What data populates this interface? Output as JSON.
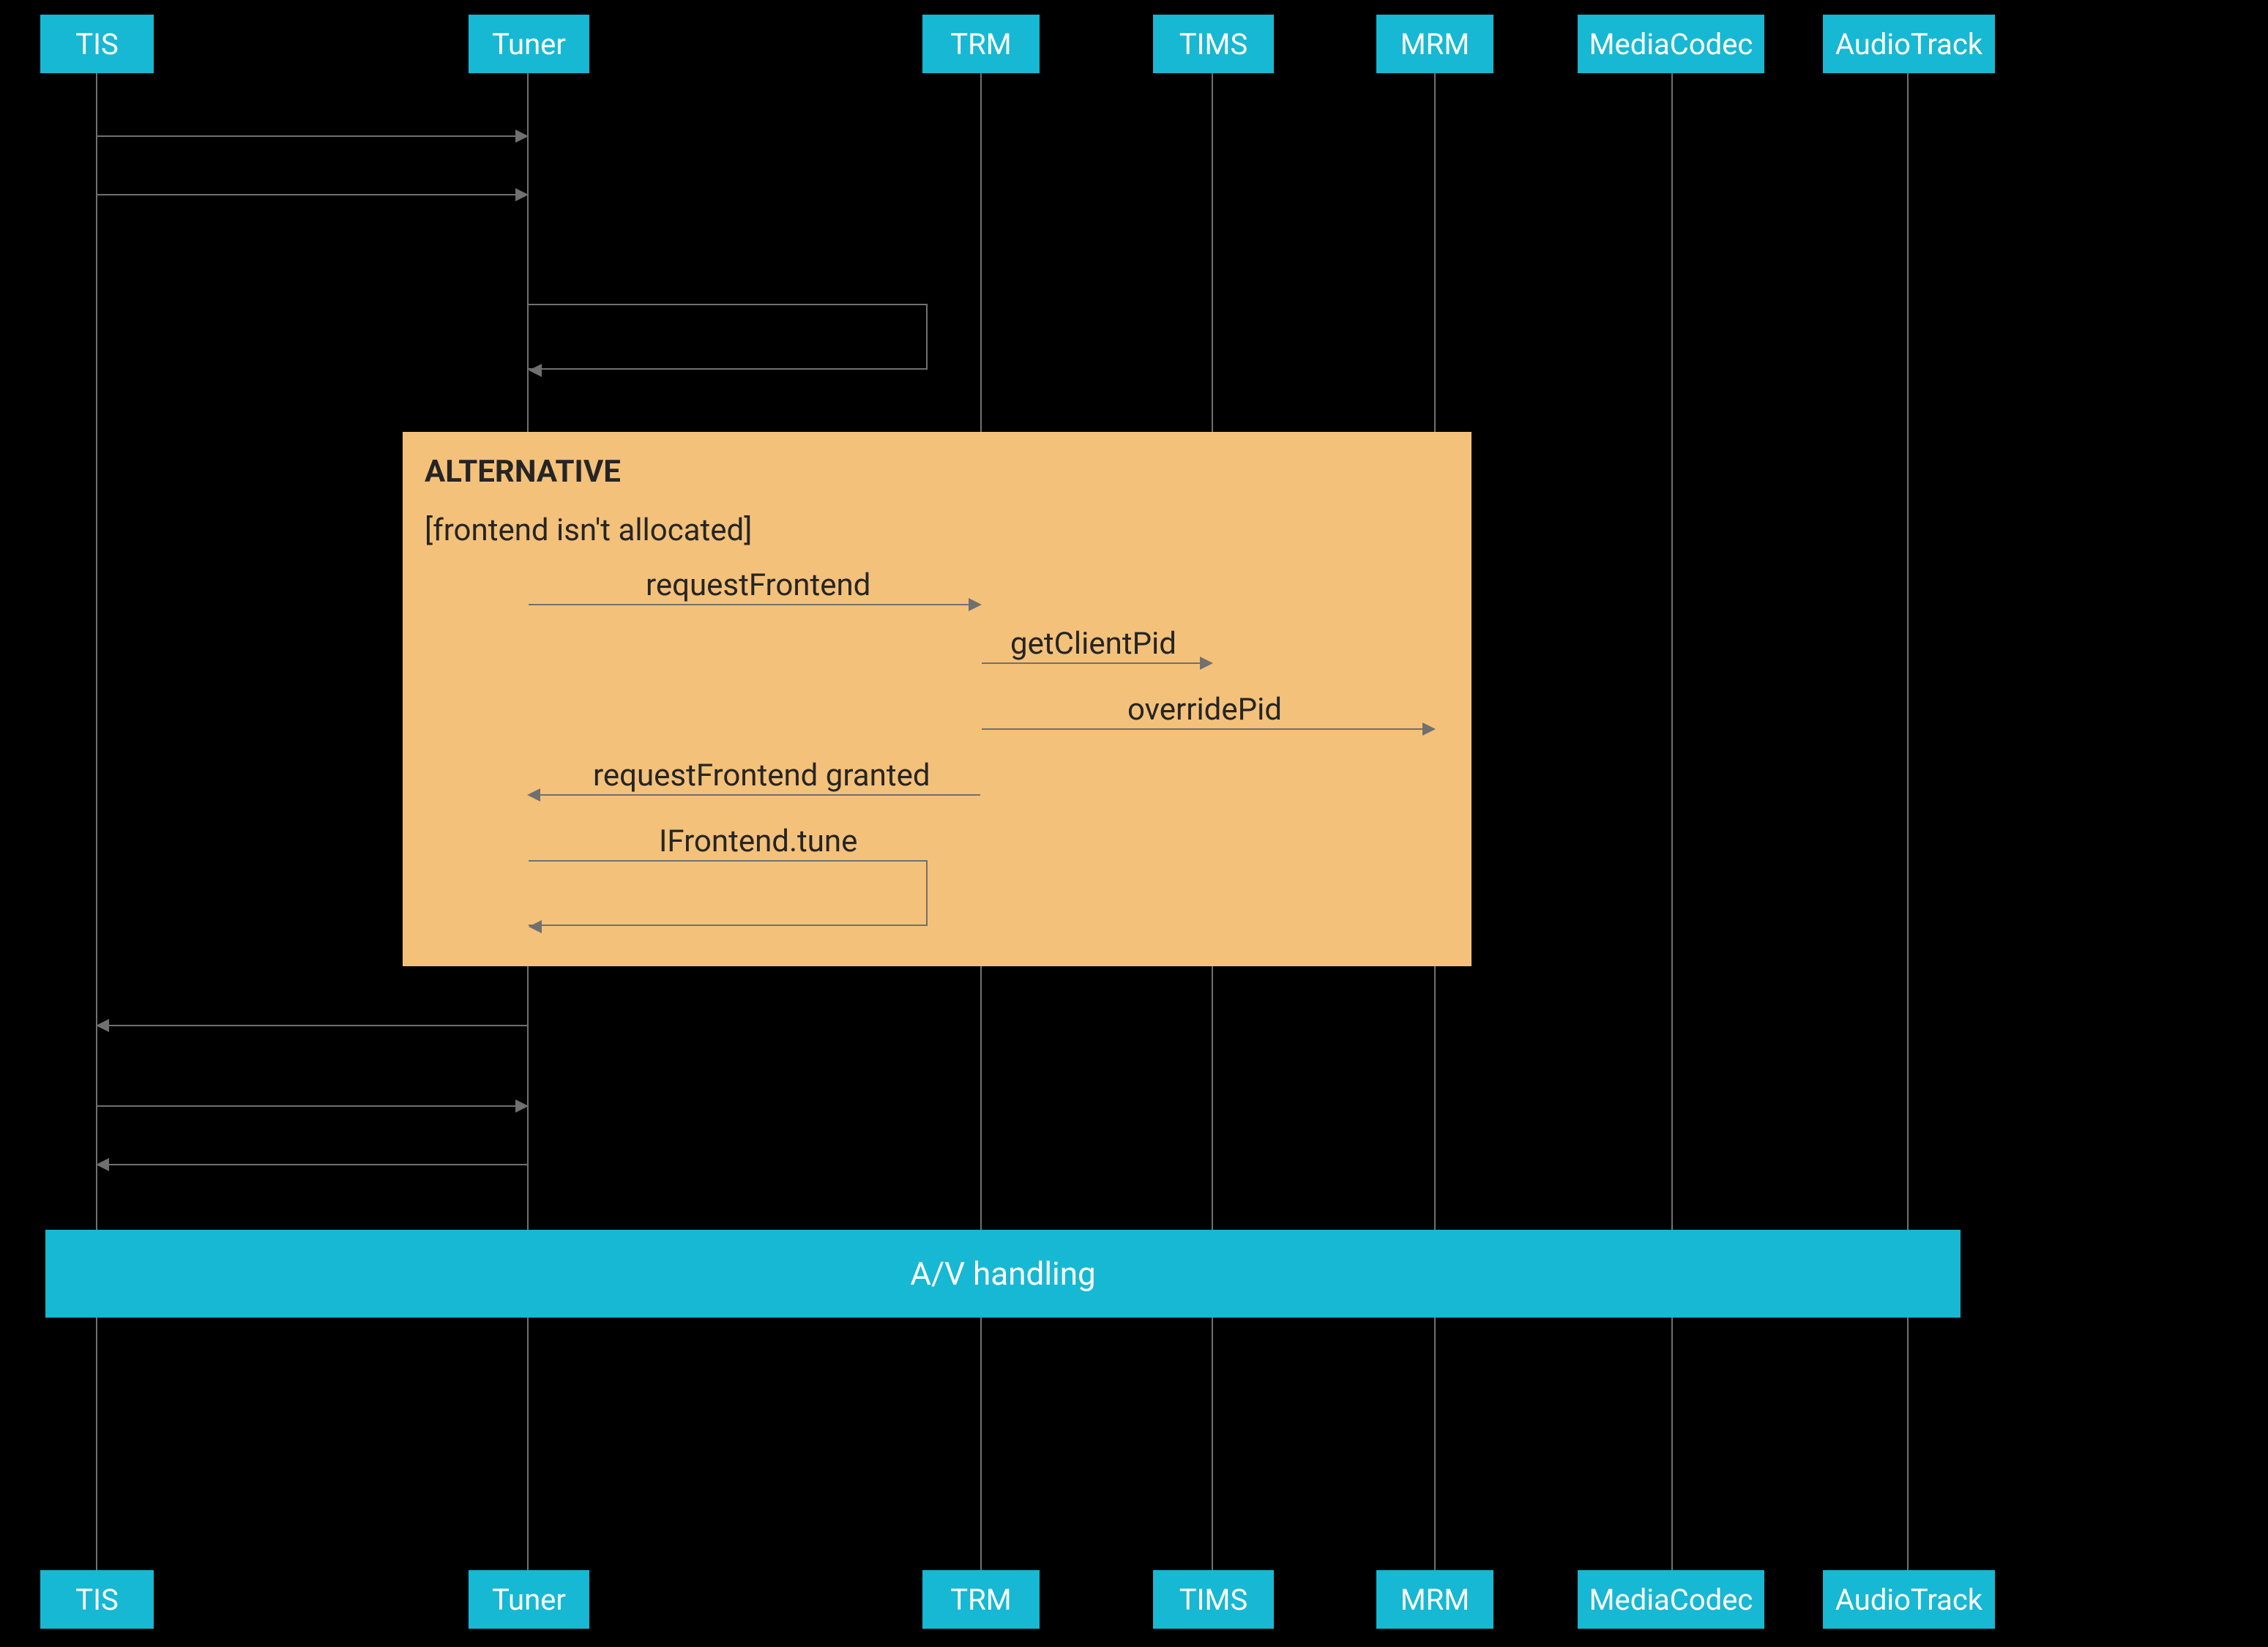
{
  "participants": [
    "TIS",
    "Tuner",
    "TRM",
    "TIMS",
    "MRM",
    "MediaCodec",
    "AudioTrack"
  ],
  "alt": {
    "title": "ALTERNATIVE",
    "guard": "[frontend isn't allocated]"
  },
  "messages": {
    "requestFrontend": "requestFrontend",
    "getClientPid": "getClientPid",
    "overridePid": "overridePid",
    "requestFrontendGranted": "requestFrontend granted",
    "ifrontendTune": "IFrontend.tune"
  },
  "bar": "A/V handling",
  "colors": {
    "teal": "#16b8d3",
    "orange": "#f4c17a",
    "arrow": "#707070",
    "bg": "#000000"
  }
}
